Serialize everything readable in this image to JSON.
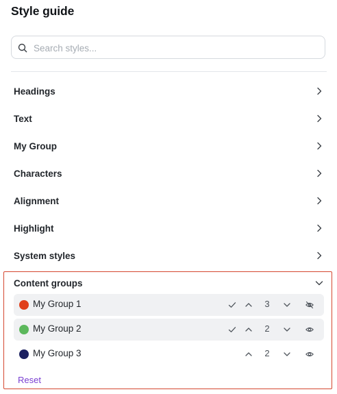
{
  "header": {
    "title": "Style guide"
  },
  "search": {
    "placeholder": "Search styles...",
    "value": ""
  },
  "sections": [
    {
      "label": "Headings"
    },
    {
      "label": "Text"
    },
    {
      "label": "My Group"
    },
    {
      "label": "Characters"
    },
    {
      "label": "Alignment"
    },
    {
      "label": "Highlight"
    },
    {
      "label": "System styles"
    }
  ],
  "content_groups": {
    "label": "Content groups",
    "expanded": true,
    "groups": [
      {
        "name": "My Group 1",
        "color": "#e0401c",
        "count": "3",
        "checked": true,
        "visible": false
      },
      {
        "name": "My Group 2",
        "color": "#5cb85c",
        "count": "2",
        "checked": true,
        "visible": true
      },
      {
        "name": "My Group 3",
        "color": "#1b2060",
        "count": "2",
        "checked": false,
        "visible": true
      }
    ],
    "reset_label": "Reset"
  },
  "colors": {
    "accent": "#7a3fd1",
    "highlight_border": "#d5462e"
  },
  "icons": {
    "search": "search-icon",
    "section_chevron": "chevron-right-icon",
    "group_chevron": "chevron-down-icon",
    "check": "check-icon",
    "up": "chevron-up-icon",
    "down": "chevron-down-icon",
    "visible": "eye-icon",
    "hidden": "eye-off-icon"
  }
}
